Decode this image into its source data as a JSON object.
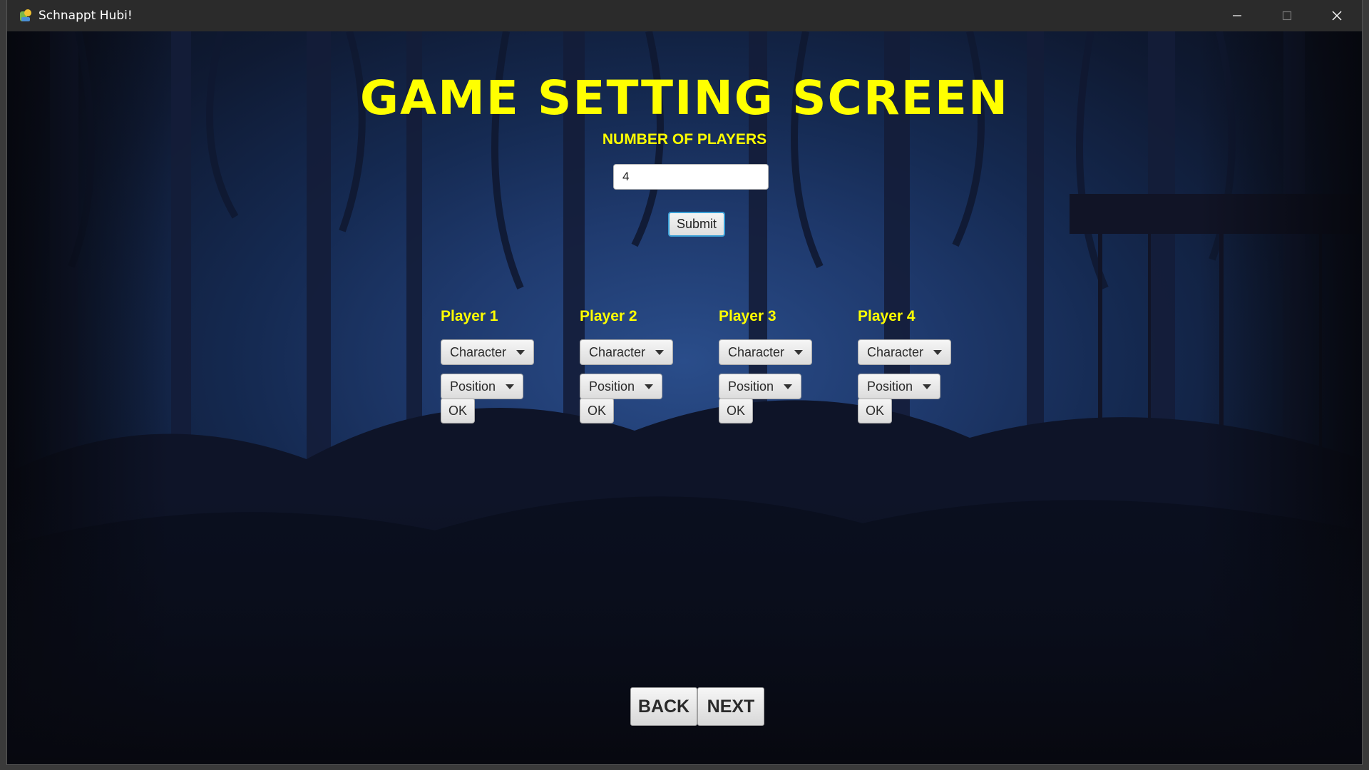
{
  "window": {
    "title": "Schnappt Hubi!",
    "icon": "app-logo-icon",
    "controls": [
      "minimize-icon",
      "maximize-icon",
      "close-icon"
    ]
  },
  "screen": {
    "title": "GAME SETTING SCREEN",
    "num_players_label": "NUMBER OF PLAYERS",
    "num_players_value": "4",
    "submit_label": "Submit"
  },
  "players": [
    {
      "label": "Player 1",
      "character": "Character",
      "position": "Position",
      "ok": "OK"
    },
    {
      "label": "Player 2",
      "character": "Character",
      "position": "Position",
      "ok": "OK"
    },
    {
      "label": "Player 3",
      "character": "Character",
      "position": "Position",
      "ok": "OK"
    },
    {
      "label": "Player 4",
      "character": "Character",
      "position": "Position",
      "ok": "OK"
    }
  ],
  "nav": {
    "back_label": "BACK",
    "next_label": "NEXT"
  },
  "colors": {
    "title_yellow": "#ffff00",
    "titlebar_bg": "#2b2b2b",
    "focus_border": "#3a9fd6"
  }
}
